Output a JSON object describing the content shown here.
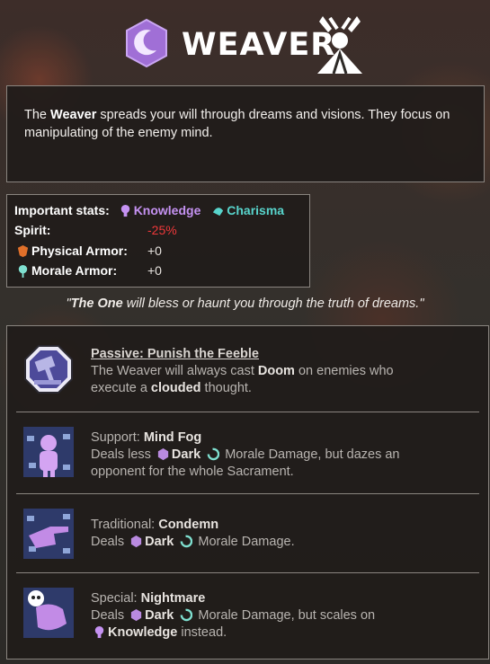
{
  "header": {
    "title": "WEAVER",
    "class_icon": "crescent-moon-hexagon-icon",
    "deity_icon": "weaver-deity-sigil-icon"
  },
  "description": {
    "pre": "The ",
    "name": "Weaver",
    "post": " spreads your will through dreams and visions. They focus on manipulating of the enemy mind."
  },
  "stats": {
    "important_label": "Important stats:",
    "stat1": "Knowledge",
    "stat2": "Charisma",
    "spirit_label": "Spirit:",
    "spirit_value": "-25%",
    "physical_label": "Physical Armor:",
    "physical_value": "+0",
    "morale_label": "Morale Armor:",
    "morale_value": "+0"
  },
  "quote": {
    "open": "\"",
    "name": "The One",
    "rest": " will bless or haunt you through the truth of dreams.\""
  },
  "abilities": [
    {
      "type": "Passive: ",
      "name": "Punish the Feeble",
      "line1_pre": "The Weaver will always cast ",
      "line1_hl": "Doom",
      "line1_post": " on enemies who",
      "line2_pre": "execute a ",
      "line2_hl": "clouded",
      "line2_post": " thought.",
      "icon": "hammer-octagon-icon"
    },
    {
      "type": "Support: ",
      "name": "Mind Fog",
      "l1_pre": "Deals less ",
      "dark": "Dark",
      "l1_post": " Morale Damage, but dazes an",
      "l2": "opponent for the whole Sacrament.",
      "icon": "mind-fog-figure-icon"
    },
    {
      "type": "Traditional: ",
      "name": "Condemn",
      "l1_pre": "Deals ",
      "dark": "Dark",
      "l1_post": " Morale Damage.",
      "icon": "pointing-hand-icon"
    },
    {
      "type": "Special: ",
      "name": "Nightmare",
      "l1_pre": "Deals ",
      "dark": "Dark",
      "l1_post": " Morale Damage, but scales on",
      "l2_hl": "Knowledge",
      "l2_post": " instead.",
      "icon": "nightmare-skull-icon"
    }
  ],
  "colors": {
    "knowledge": "#c592f2",
    "charisma": "#58d4cc",
    "negative": "#f0383a",
    "dark_hex": "#b98ae0"
  }
}
